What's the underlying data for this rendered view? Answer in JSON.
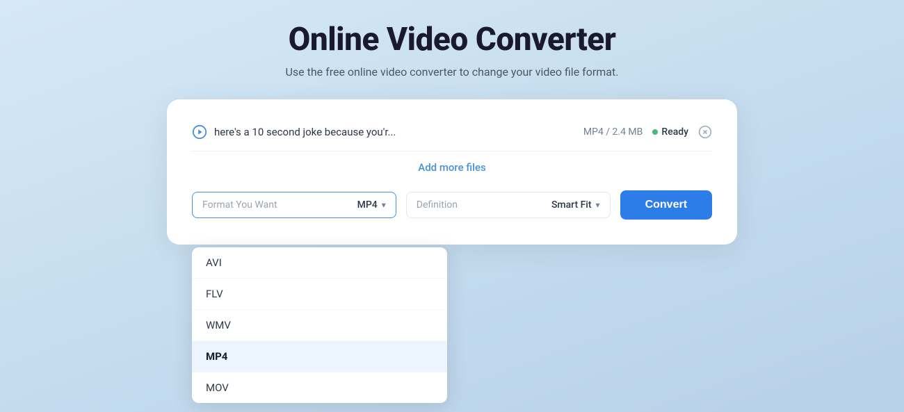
{
  "header": {
    "title": "Online Video Converter",
    "subtitle": "Use the free online video converter to change your video file format."
  },
  "file_row": {
    "file_name": "here's a 10 second joke because you'r...",
    "file_meta": "MP4 / 2.4 MB",
    "status": "Ready",
    "add_more_label": "Add more files"
  },
  "controls": {
    "format_label": "Format You Want",
    "format_value": "MP4",
    "definition_label": "Definition",
    "definition_value": "Smart Fit",
    "convert_label": "Convert"
  },
  "dropdown": {
    "items": [
      {
        "label": "AVI",
        "selected": false
      },
      {
        "label": "FLV",
        "selected": false
      },
      {
        "label": "WMV",
        "selected": false
      },
      {
        "label": "MP4",
        "selected": true
      },
      {
        "label": "MOV",
        "selected": false
      }
    ]
  },
  "colors": {
    "accent": "#2d7de8",
    "status_green": "#48bb78"
  }
}
